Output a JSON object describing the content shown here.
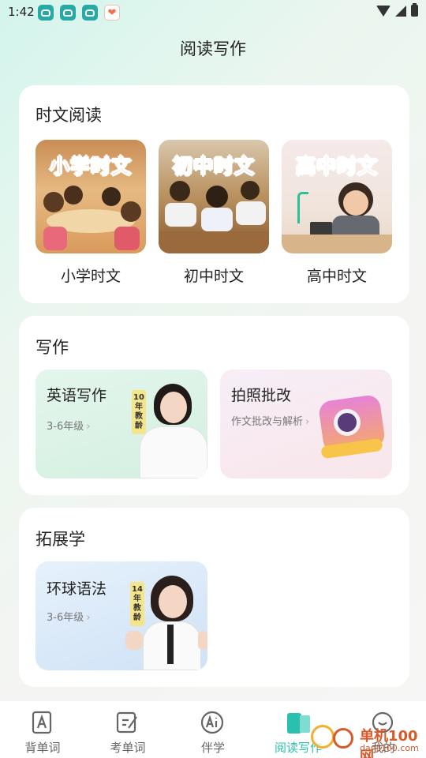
{
  "status_bar": {
    "time": "1:42"
  },
  "header": {
    "title": "阅读写作"
  },
  "reading": {
    "title": "时文阅读",
    "items": [
      {
        "banner": "小学时文",
        "label": "小学时文"
      },
      {
        "banner": "初中时文",
        "label": "初中时文"
      },
      {
        "banner": "高中时文",
        "label": "高中时文"
      }
    ]
  },
  "writing": {
    "title": "写作",
    "english": {
      "title": "英语写作",
      "sub": "3-6年级",
      "badge": "10年教龄"
    },
    "photo": {
      "title": "拍照批改",
      "sub": "作文批改与解析"
    }
  },
  "extended": {
    "title": "拓展学",
    "grammar": {
      "title": "环球语法",
      "sub": "3-6年级",
      "badge": "14年教龄"
    }
  },
  "bottom_nav": {
    "items": [
      {
        "label": "背单词",
        "icon": "a-book-icon"
      },
      {
        "label": "考单词",
        "icon": "edit-icon"
      },
      {
        "label": "伴学",
        "icon": "ai-icon"
      },
      {
        "label": "阅读写作",
        "icon": "open-book-icon",
        "active": true
      },
      {
        "label": "我的",
        "icon": "smile-icon"
      }
    ]
  },
  "watermark": {
    "text": "单机100网",
    "sub": "danji100.com"
  },
  "colors": {
    "accent": "#2bbfad",
    "status_icon": "#29a9a6"
  }
}
